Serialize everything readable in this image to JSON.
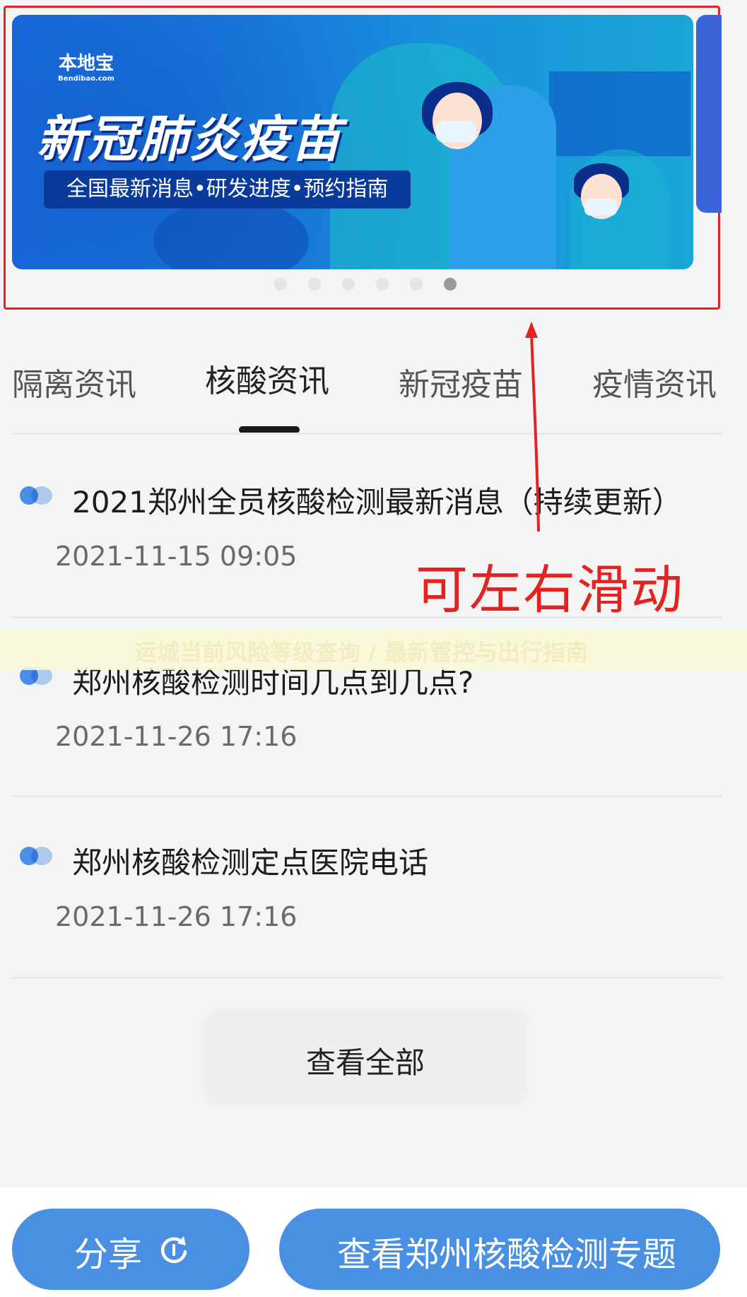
{
  "banner": {
    "logo_main": "本地宝",
    "logo_sub": "Bendibao.com",
    "headline": "新冠肺炎疫苗",
    "subline": "全国最新消息•研发进度•预约指南",
    "dots": [
      false,
      false,
      false,
      false,
      false,
      true
    ]
  },
  "annotation": {
    "swipe_note": "可左右滑动",
    "accent_color": "#e32222"
  },
  "tabs": [
    {
      "label": "隔离资讯",
      "active": false
    },
    {
      "label": "核酸资讯",
      "active": true
    },
    {
      "label": "新冠疫苗",
      "active": false
    },
    {
      "label": "疫情资讯",
      "active": false
    }
  ],
  "news": [
    {
      "title": "2021郑州全员核酸检测最新消息（持续更新）",
      "date": "2021-11-15 09:05"
    },
    {
      "title": "郑州核酸检测时间几点到几点?",
      "date": "2021-11-26 17:16"
    },
    {
      "title": "郑州核酸检测定点医院电话",
      "date": "2021-11-26 17:16"
    }
  ],
  "ticker": {
    "text": "运城当前风险等级查询 / 最新管控与出行指南"
  },
  "view_all": {
    "label": "查看全部"
  },
  "bottom_bar": {
    "share_label": "分享",
    "share_icon": "share-refresh-icon",
    "topic_label": "查看郑州核酸检测专题",
    "button_color": "#4a90e2"
  }
}
